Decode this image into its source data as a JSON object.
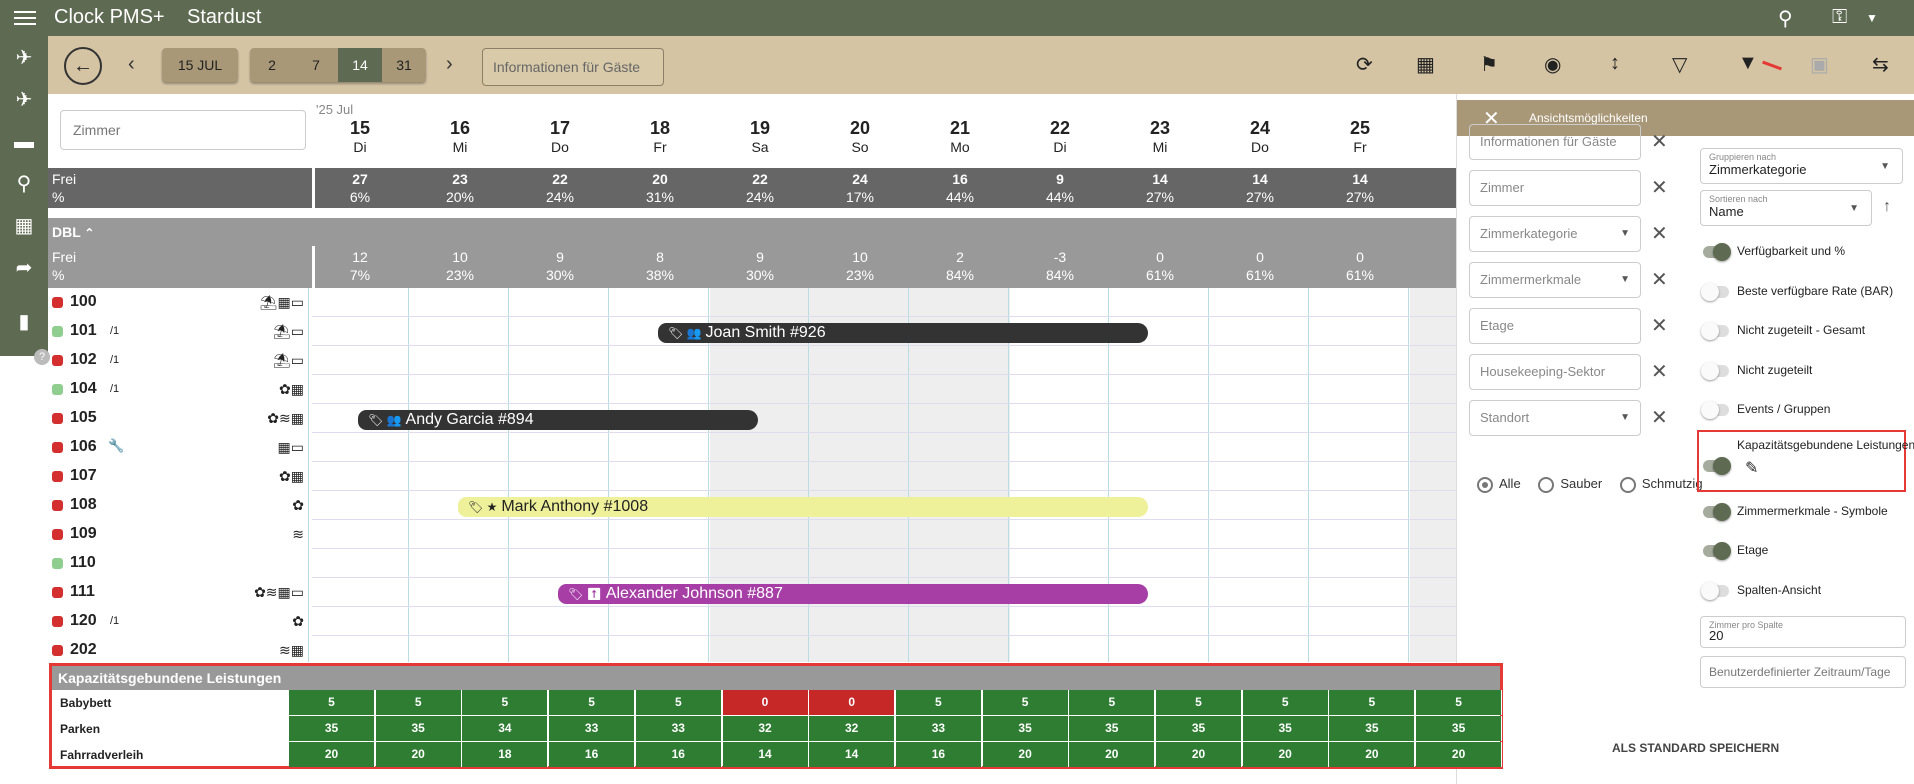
{
  "header": {
    "app_title": "Clock PMS+",
    "property": "Stardust"
  },
  "toolbar": {
    "date_button": "15 JUL",
    "day_spans": [
      "2",
      "7",
      "14",
      "31"
    ],
    "active_span": "14",
    "info_button": "Informationen für Gäste"
  },
  "calendar": {
    "search_placeholder": "Zimmer",
    "year_month": "'25 Jul",
    "days": [
      {
        "num": "15",
        "wd": "Di"
      },
      {
        "num": "16",
        "wd": "Mi"
      },
      {
        "num": "17",
        "wd": "Do"
      },
      {
        "num": "18",
        "wd": "Fr"
      },
      {
        "num": "19",
        "wd": "Sa"
      },
      {
        "num": "20",
        "wd": "So"
      },
      {
        "num": "21",
        "wd": "Mo"
      },
      {
        "num": "22",
        "wd": "Di"
      },
      {
        "num": "23",
        "wd": "Mi"
      },
      {
        "num": "24",
        "wd": "Do"
      },
      {
        "num": "25",
        "wd": "Fr"
      }
    ],
    "overall": {
      "free_label": "Frei",
      "pct_label": "%",
      "free": [
        "27",
        "23",
        "22",
        "20",
        "22",
        "24",
        "16",
        "9",
        "14",
        "14",
        "14"
      ],
      "pct": [
        "6%",
        "20%",
        "24%",
        "31%",
        "24%",
        "17%",
        "44%",
        "44%",
        "27%",
        "27%",
        "27%"
      ]
    },
    "category": {
      "name": "DBL",
      "free_label": "Frei",
      "pct_label": "%",
      "free": [
        "12",
        "10",
        "9",
        "8",
        "9",
        "10",
        "2",
        "-3",
        "0",
        "0",
        "0"
      ],
      "pct": [
        "7%",
        "23%",
        "30%",
        "38%",
        "30%",
        "23%",
        "84%",
        "84%",
        "61%",
        "61%",
        "61%"
      ]
    },
    "rooms": [
      {
        "num": "100",
        "floor": "",
        "status": "#d32f2f",
        "icons": "⛱▦▭"
      },
      {
        "num": "101",
        "floor": "/1",
        "status": "#8fce8f",
        "icons": "⛱▭"
      },
      {
        "num": "102",
        "floor": "/1",
        "status": "#d32f2f",
        "icons": "⛱▭"
      },
      {
        "num": "104",
        "floor": "/1",
        "status": "#8fce8f",
        "icons": "✿▦"
      },
      {
        "num": "105",
        "floor": "",
        "status": "#d32f2f",
        "icons": "✿≋▦"
      },
      {
        "num": "106",
        "floor": "",
        "status": "#d32f2f",
        "icons": "▦▭"
      },
      {
        "num": "107",
        "floor": "",
        "status": "#d32f2f",
        "icons": "✿▦"
      },
      {
        "num": "108",
        "floor": "",
        "status": "#d32f2f",
        "icons": "✿"
      },
      {
        "num": "109",
        "floor": "",
        "status": "#d32f2f",
        "icons": "≋"
      },
      {
        "num": "110",
        "floor": "",
        "status": "#8fce8f",
        "icons": ""
      },
      {
        "num": "111",
        "floor": "",
        "status": "#d32f2f",
        "icons": "✿≋▦▭"
      },
      {
        "num": "120",
        "floor": "/1",
        "status": "#d32f2f",
        "icons": "✿"
      },
      {
        "num": "202",
        "floor": "",
        "status": "#d32f2f",
        "icons": "≋▦"
      }
    ],
    "bookings": [
      {
        "name": "Joan Smith #926",
        "color": "#333333",
        "text": "#ffffff",
        "row": 1,
        "start": 3.5,
        "end": 8.4,
        "sym": "👥"
      },
      {
        "name": "Andy Garcia #894",
        "color": "#333333",
        "text": "#ffffff",
        "row": 4,
        "start": 0.5,
        "end": 4.5,
        "sym": "👥"
      },
      {
        "name": "Mark Anthony #1008",
        "color": "#eef19a",
        "text": "#222222",
        "row": 7,
        "start": 1.5,
        "end": 8.4,
        "sym": "★"
      },
      {
        "name": "Alexander Johnson #887",
        "color": "#a63ea6",
        "text": "#ffffff",
        "row": 10,
        "start": 2.5,
        "end": 8.4,
        "sym": "⬆"
      }
    ]
  },
  "panel": {
    "title": "Ansichtsmöglichkeiten",
    "filters": [
      {
        "label": "Informationen für Gäste",
        "dd": false
      },
      {
        "label": "Zimmer",
        "dd": false
      },
      {
        "label": "Zimmerkategorie",
        "dd": true
      },
      {
        "label": "Zimmermerkmale",
        "dd": true
      },
      {
        "label": "Etage",
        "dd": false
      },
      {
        "label": "Housekeeping-Sektor",
        "dd": false
      },
      {
        "label": "Standort",
        "dd": true
      }
    ],
    "radios": {
      "all": "Alle",
      "clean": "Sauber",
      "dirty": "Schmutzig"
    },
    "group_label": "Gruppieren nach",
    "group_value": "Zimmerkategorie",
    "sort_label": "Sortieren nach",
    "sort_value": "Name",
    "toggles": [
      {
        "label": "Verfügbarkeit und %",
        "on": true
      },
      {
        "label": "Beste verfügbare Rate (BAR)",
        "on": false
      },
      {
        "label": "Nicht zugeteilt - Gesamt",
        "on": false
      },
      {
        "label": "Nicht zugeteilt",
        "on": false
      },
      {
        "label": "Events / Gruppen",
        "on": false
      },
      {
        "label": "Kapazitätsgebundene Leistungen",
        "on": true
      },
      {
        "label": "Zimmermerkmale - Symbole",
        "on": true
      },
      {
        "label": "Etage",
        "on": true
      },
      {
        "label": "Spalten-Ansicht",
        "on": false
      }
    ],
    "rooms_per_col_label": "Zimmer pro Spalte",
    "rooms_per_col_value": "20",
    "custom_range_placeholder": "Benutzerdefinierter Zeitraum/Tage",
    "save_default": "ALS STANDARD SPEICHERN"
  },
  "capacity": {
    "title": "Kapazitätsgebundene Leistungen",
    "rows": [
      {
        "name": "Babybett",
        "values": [
          "5",
          "5",
          "5",
          "5",
          "5",
          "0",
          "0",
          "5",
          "5",
          "5",
          "5",
          "5",
          "5",
          "5"
        ]
      },
      {
        "name": "Parken",
        "values": [
          "35",
          "35",
          "34",
          "33",
          "33",
          "32",
          "32",
          "33",
          "35",
          "35",
          "35",
          "35",
          "35",
          "35"
        ]
      },
      {
        "name": "Fahrradverleih",
        "values": [
          "20",
          "20",
          "18",
          "16",
          "16",
          "14",
          "14",
          "16",
          "20",
          "20",
          "20",
          "20",
          "20",
          "20"
        ]
      }
    ]
  }
}
